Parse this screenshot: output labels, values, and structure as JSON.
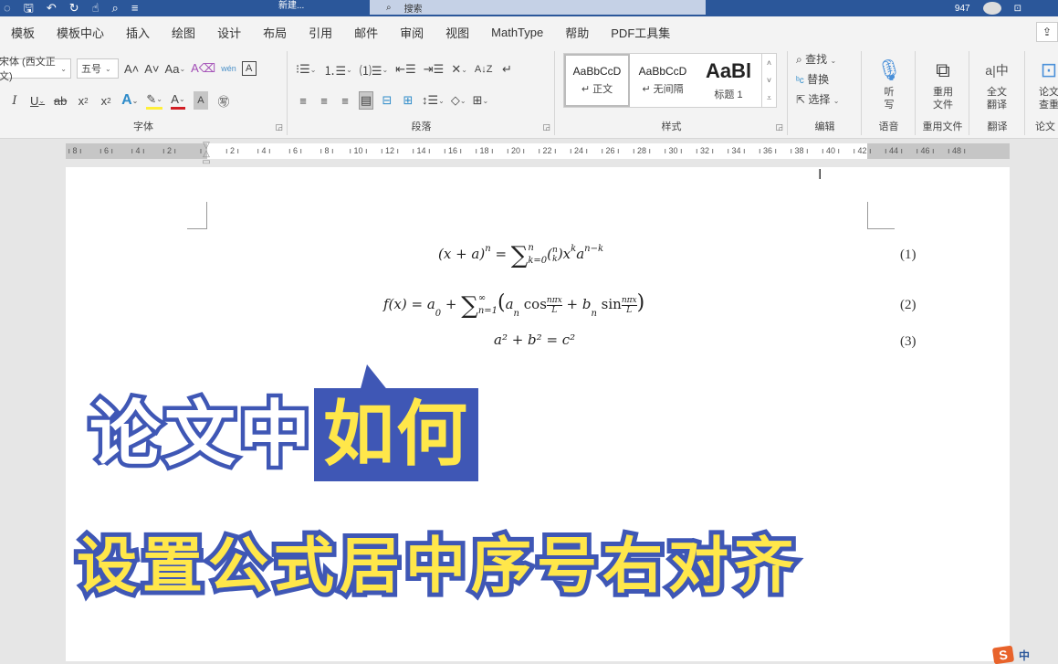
{
  "titlebar": {
    "qat_icons": [
      "autosave-icon",
      "save-icon",
      "undo-icon",
      "redo-icon",
      "touch-mode-icon",
      "search-icon",
      "customize-qat-icon"
    ],
    "doc_title": "新建...",
    "search_placeholder": "搜索",
    "user_count": "947",
    "colors": {
      "titlebar": "#2b579a",
      "search": "#c5d1e6"
    }
  },
  "tabs": [
    "模板",
    "模板中心",
    "插入",
    "绘图",
    "设计",
    "布局",
    "引用",
    "邮件",
    "审阅",
    "视图",
    "MathType",
    "帮助",
    "PDF工具集"
  ],
  "ribbon": {
    "font": {
      "font_name": "宋体 (西文正文)",
      "font_size": "五号",
      "label": "字体",
      "row1_icons": [
        "A^",
        "Aˇ",
        "Aa",
        "Ꭿ",
        "wén",
        "A"
      ],
      "row2_icons": [
        "I",
        "U",
        "ab",
        "x₂",
        "x²",
        "A",
        "✎",
        "A",
        "A",
        "㊢"
      ]
    },
    "paragraph": {
      "label": "段落",
      "row1_icons": [
        "⁝☰",
        "⒈☰",
        "⑴☰",
        "⇤☰",
        "⇥☰",
        "✕",
        "A↓Z",
        "↵"
      ],
      "row2_icons": [
        "≡",
        "≡",
        "≡",
        "▦",
        "⊟",
        "⊞",
        "↕☰",
        "◇",
        "⊞"
      ]
    },
    "styles": {
      "label": "样式",
      "items": [
        {
          "sample": "AaBbCcD",
          "name": "↵ 正文",
          "selected": true
        },
        {
          "sample": "AaBbCcD",
          "name": "↵ 无间隔",
          "selected": false
        },
        {
          "sample": "AaBl",
          "name": "标题 1",
          "selected": false
        }
      ]
    },
    "editing": {
      "label": "编辑",
      "items": [
        "查找",
        "替换",
        "选择"
      ]
    },
    "voice": {
      "button": "听写",
      "label": "语音"
    },
    "reuse": {
      "button": "重用文件",
      "label": "重用文件"
    },
    "translate": {
      "button": "全文翻译",
      "label": "翻译"
    },
    "paper": {
      "button": "论文查重",
      "label": "论文"
    }
  },
  "ruler": {
    "numbers": [
      "8",
      "6",
      "4",
      "2",
      "",
      "2",
      "4",
      "6",
      "8",
      "10",
      "12",
      "14",
      "16",
      "18",
      "20",
      "22",
      "24",
      "26",
      "28",
      "30",
      "32",
      "34",
      "36",
      "38",
      "40",
      "42",
      "44",
      "46",
      "48"
    ]
  },
  "document": {
    "equations": [
      {
        "lhs": "(x + a)",
        "number": "(1)"
      },
      {
        "lhs": "f(x) = a",
        "number": "(2)"
      },
      {
        "lhs": "a² + b² = c²",
        "number": "(3)"
      }
    ],
    "overlay_title_line1_white": "论文中",
    "overlay_title_line1_yellow": "如何",
    "overlay_title_line2": "设置公式居中序号右对齐",
    "colors": {
      "outline_blue": "#3f57b5",
      "yellow": "#ffe74a"
    }
  },
  "taskbar": {
    "ime_logo": "S",
    "ime_mode": "中"
  }
}
